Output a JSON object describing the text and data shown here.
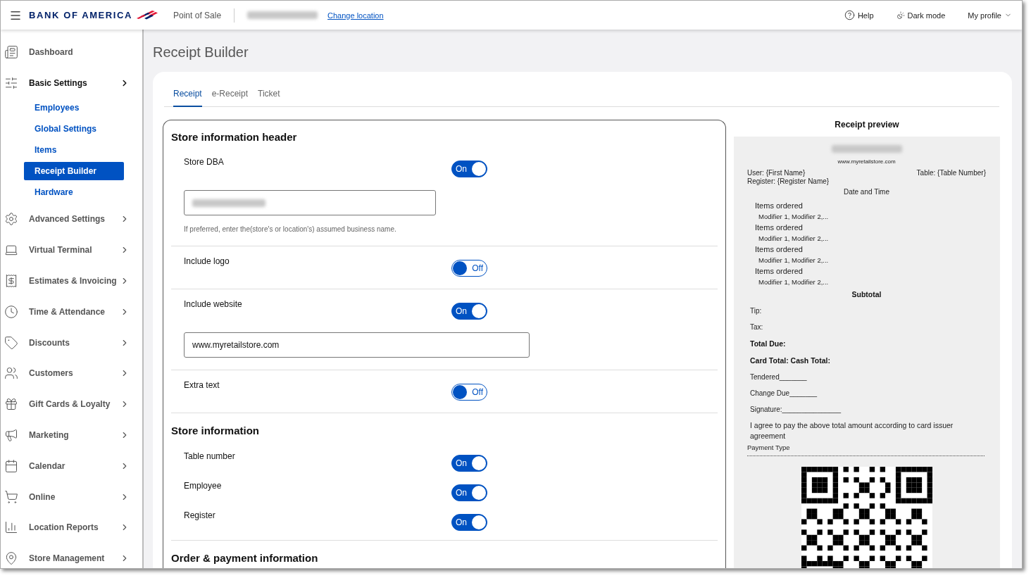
{
  "header": {
    "brand": "BANK OF AMERICA",
    "app": "Point of Sale",
    "change_location": "Change location",
    "help": "Help",
    "dark_mode": "Dark mode",
    "profile": "My profile"
  },
  "sidebar": {
    "items": [
      {
        "label": "Dashboard",
        "kind": "link"
      },
      {
        "label": "Basic Settings",
        "kind": "menu",
        "expanded": true,
        "children": [
          {
            "label": "Employees",
            "selected": false
          },
          {
            "label": "Global Settings",
            "selected": false
          },
          {
            "label": "Items",
            "selected": false
          },
          {
            "label": "Receipt Builder",
            "selected": true
          },
          {
            "label": "Hardware",
            "selected": false
          }
        ]
      },
      {
        "label": "Advanced Settings",
        "kind": "menu",
        "expanded": false
      },
      {
        "label": "Virtual Terminal",
        "kind": "menu",
        "expanded": false
      },
      {
        "label": "Estimates & Invoicing",
        "kind": "menu",
        "expanded": false
      },
      {
        "label": "Time & Attendance",
        "kind": "menu",
        "expanded": false
      },
      {
        "label": "Discounts",
        "kind": "menu",
        "expanded": false
      },
      {
        "label": "Customers",
        "kind": "menu",
        "expanded": false
      },
      {
        "label": "Gift Cards & Loyalty",
        "kind": "menu",
        "expanded": false
      },
      {
        "label": "Marketing",
        "kind": "menu",
        "expanded": false
      },
      {
        "label": "Calendar",
        "kind": "menu",
        "expanded": false
      },
      {
        "label": "Online",
        "kind": "menu",
        "expanded": false
      },
      {
        "label": "Location Reports",
        "kind": "menu",
        "expanded": false
      },
      {
        "label": "Store Management",
        "kind": "menu",
        "expanded": false
      }
    ]
  },
  "page_title": "Receipt Builder",
  "tabs": [
    {
      "label": "Receipt",
      "selected": true
    },
    {
      "label": "e-Receipt",
      "selected": false
    },
    {
      "label": "Ticket",
      "selected": false
    }
  ],
  "sections": [
    {
      "title": "Store information header",
      "divided": true,
      "rows": [
        {
          "label": "Store DBA",
          "on": true,
          "toggle_label": "On",
          "field": {
            "kind": "redacted"
          },
          "hint": "If preferred, enter the(store's or location's) assumed business name."
        },
        {
          "label": "Include logo",
          "on": false,
          "toggle_label": "Off"
        },
        {
          "label": "Include website",
          "on": true,
          "toggle_label": "On",
          "field": {
            "kind": "text",
            "value": "www.myretailstore.com"
          }
        },
        {
          "label": "Extra text",
          "on": false,
          "toggle_label": "Off"
        }
      ]
    },
    {
      "title": "Store information",
      "divided": false,
      "rows": [
        {
          "label": "Table number",
          "on": true,
          "toggle_label": "On"
        },
        {
          "label": "Employee",
          "on": true,
          "toggle_label": "On"
        },
        {
          "label": "Register",
          "on": true,
          "toggle_label": "On"
        }
      ]
    },
    {
      "title": "Order & payment information"
    }
  ],
  "preview": {
    "title": "Receipt preview",
    "lines": [
      {
        "kind": "redacted"
      },
      {
        "kind": "website",
        "text": "www.myretailstore.com"
      },
      {
        "kind": "pair",
        "text": "User: {First Name}",
        "right": "Table: {Table Number}"
      },
      {
        "kind": "plain",
        "text": "Register: {Register Name}"
      },
      {
        "kind": "center",
        "text": "Date and Time"
      },
      {
        "kind": "item",
        "text": "Items ordered"
      },
      {
        "kind": "modifier",
        "text": "Modifier 1, Modifier 2,..."
      },
      {
        "kind": "item",
        "text": "Items ordered"
      },
      {
        "kind": "modifier",
        "text": "Modifier 1, Modifier 2,..."
      },
      {
        "kind": "item",
        "text": "Items ordered"
      },
      {
        "kind": "modifier",
        "text": "Modifier 1, Modifier 2,..."
      },
      {
        "kind": "item",
        "text": "Items ordered"
      },
      {
        "kind": "modifier",
        "text": "Modifier 1, Modifier 2,..."
      },
      {
        "kind": "subtotal",
        "text": "Subtotal"
      },
      {
        "kind": "total",
        "text": "Tip:"
      },
      {
        "kind": "total",
        "text": "Tax:"
      },
      {
        "kind": "bold",
        "text": "Total Due:"
      },
      {
        "kind": "bold",
        "text": "Card Total: Cash Total:"
      },
      {
        "kind": "total",
        "text": "Tendered_______"
      },
      {
        "kind": "total",
        "text": "Change Due_______"
      },
      {
        "kind": "total",
        "text": "Signature:_______________"
      },
      {
        "kind": "agree",
        "text": "I agree to pay the above total amount according to card issuer agreement"
      },
      {
        "kind": "payment",
        "text": "Payment Type"
      },
      {
        "kind": "qr"
      }
    ]
  }
}
